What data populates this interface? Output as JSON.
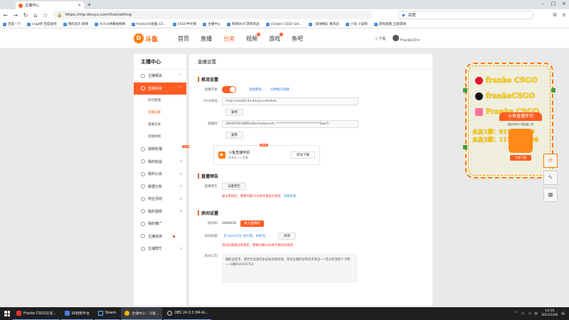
{
  "browser": {
    "tab_title": "主播中心",
    "url": "https://mp.douyu.com/live/setting",
    "search_engine": "百度",
    "bookmarks": [
      "百度一下",
      "csgo吧-百度贴吧",
      "我的首页 微博",
      "AcFun弹幕视频网",
      "franke19直播_CS...",
      "CSGO中文网",
      "主播中心",
      "网易BUFF游戏饰品",
      "s1mple CSGO Set...",
      "【新播报】看饰品",
      "小说 小说网",
      "游戏直播_全部游戏"
    ]
  },
  "site": {
    "logo_text": "斗鱼",
    "nav": [
      "首页",
      "直播",
      "分类",
      "视频",
      "游戏",
      "鱼吧"
    ],
    "download": "下载",
    "username": "Franke19"
  },
  "sidebar": {
    "title": "主播中心",
    "items": [
      {
        "label": "主播相关",
        "arrow": "^"
      },
      {
        "label": "直播相关",
        "arrow": "^"
      },
      {
        "label": "房间管理"
      },
      {
        "label": "直播设置"
      },
      {
        "label": "直播记录"
      },
      {
        "label": "剪辑视频"
      },
      {
        "label": "视频轮播",
        "tag": "NEW"
      },
      {
        "label": "我的收益",
        "arrow": "v"
      },
      {
        "label": "我的公会",
        "arrow": "v"
      },
      {
        "label": "数据分析",
        "arrow": "v"
      },
      {
        "label": "商业活动",
        "arrow": "v"
      },
      {
        "label": "我的视频",
        "arrow": "v"
      },
      {
        "label": "我的推广"
      },
      {
        "label": "主播扶持"
      },
      {
        "label": "主播帮忙",
        "arrow": "v"
      }
    ]
  },
  "main": {
    "page_title": "直播设置",
    "push": {
      "title": "推流设置",
      "switch_label": "直播开关:",
      "link1": "直播教程",
      "link2": "切换推流线路",
      "rtmp_label": "rtmp地址:",
      "rtmp_value": "rtmp://sendtc3a.douyu.com/live",
      "copy1": "复制",
      "code_label": "直播码:",
      "code_value": "3494554rSW82oBio?wsSecret=***************************&wsTi",
      "copy2": "复制",
      "companion_name": "斗鱼直播伴侣",
      "companion_desc": "高清流 1.0 直播",
      "companion_badge": "NEW",
      "companion_btn": "前往下载"
    },
    "preview": {
      "title": "直播预告",
      "label": "直播预告:",
      "btn": "设置预告",
      "warn": "通过审核后，需要间隔10分钟才能再次修改",
      "warn_link": "查看说明"
    },
    "room": {
      "title": "房间设置",
      "id_label": "房间ID:",
      "id_value": "3494554",
      "enter_btn": "进入直播间",
      "name_label": "房间标题:",
      "name_value": "【Franke19】讲文明，树新风",
      "edit_btn": "修改",
      "name_warn": "房间标题通过审核后，需要间隔10分钟才能再次修改",
      "notice_label": "房间公告:",
      "notice_text": "做职业选手，曾经为过国内多支知名俱乐部，常欢主播的记得点点关注~~可以的话给个卡梯~~Q群915035753"
    }
  },
  "overlay": {
    "lines": [
      "franke CSGO",
      "frankeCSGO",
      "Franke CSGO"
    ],
    "qq_lines": [
      "水友1群：915035753",
      "水友2群：1178476108"
    ],
    "card_head": "斗鱼直播伴侣",
    "card_sub": "最好用的PC端直播工具",
    "card_btn": "立即下载"
  },
  "taskbar": {
    "tasks": [
      "Franke CSGO交流...",
      "SE控制平台",
      "Steam",
      "主播中心 - 斗鱼...",
      "OBS 24.0.3 (64-bi..."
    ],
    "time": "14:16",
    "date": "2021/10/6",
    "lang": "中"
  },
  "colors": {
    "accent": "#ff5d23",
    "link": "#3a8be0",
    "overlay_text": "#ffd400"
  }
}
